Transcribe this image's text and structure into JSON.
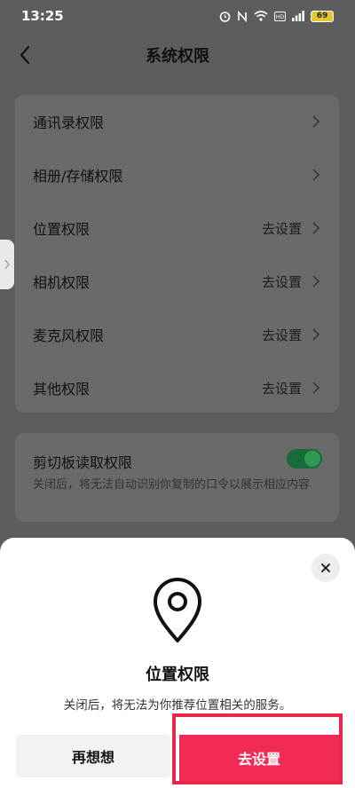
{
  "status_bar": {
    "time": "13:25",
    "battery": "69"
  },
  "header": {
    "title": "系统权限"
  },
  "permissions": [
    {
      "label": "通讯录权限",
      "action": ""
    },
    {
      "label": "相册/存储权限",
      "action": ""
    },
    {
      "label": "位置权限",
      "action": "去设置"
    },
    {
      "label": "相机权限",
      "action": "去设置"
    },
    {
      "label": "麦克风权限",
      "action": "去设置"
    },
    {
      "label": "其他权限",
      "action": "去设置"
    }
  ],
  "clipboard": {
    "title": "剪切板读取权限",
    "description": "关闭后，将无法自动识别你复制的口令以展示相应内容",
    "enabled": true
  },
  "sheet": {
    "title": "位置权限",
    "description": "关闭后，将无法为你推荐位置相关的服务。",
    "cancel_label": "再想想",
    "confirm_label": "去设置"
  },
  "colors": {
    "accent": "#f22b54",
    "toggle_on": "#2f9a52"
  }
}
